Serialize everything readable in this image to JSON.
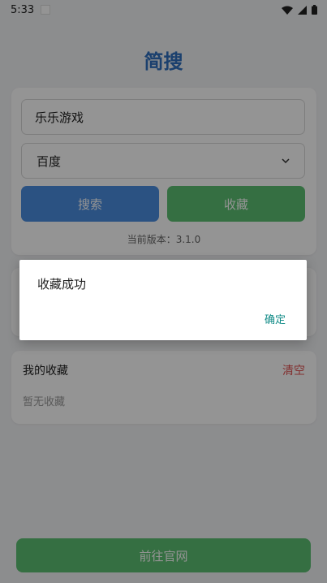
{
  "status_bar": {
    "time": "5:33"
  },
  "app": {
    "title": "简搜"
  },
  "search": {
    "input_value": "乐乐游戏",
    "engine_selected": "百度",
    "search_button": "搜索",
    "favorite_button": "收藏",
    "version_text": "当前版本：3.1.0"
  },
  "favorites": {
    "title": "我的收藏",
    "clear_label": "清空",
    "empty_text": "暂无收藏"
  },
  "footer": {
    "official_site_button": "前往官网"
  },
  "dialog": {
    "message": "收藏成功",
    "confirm_label": "确定"
  },
  "colors": {
    "primary_blue": "#4a8de0",
    "primary_green": "#5cbf72",
    "danger_red": "#e05050",
    "dialog_action": "#0f8a86"
  },
  "icons": [
    "wifi-icon",
    "signal-icon",
    "battery-icon",
    "chevron-down-icon"
  ]
}
